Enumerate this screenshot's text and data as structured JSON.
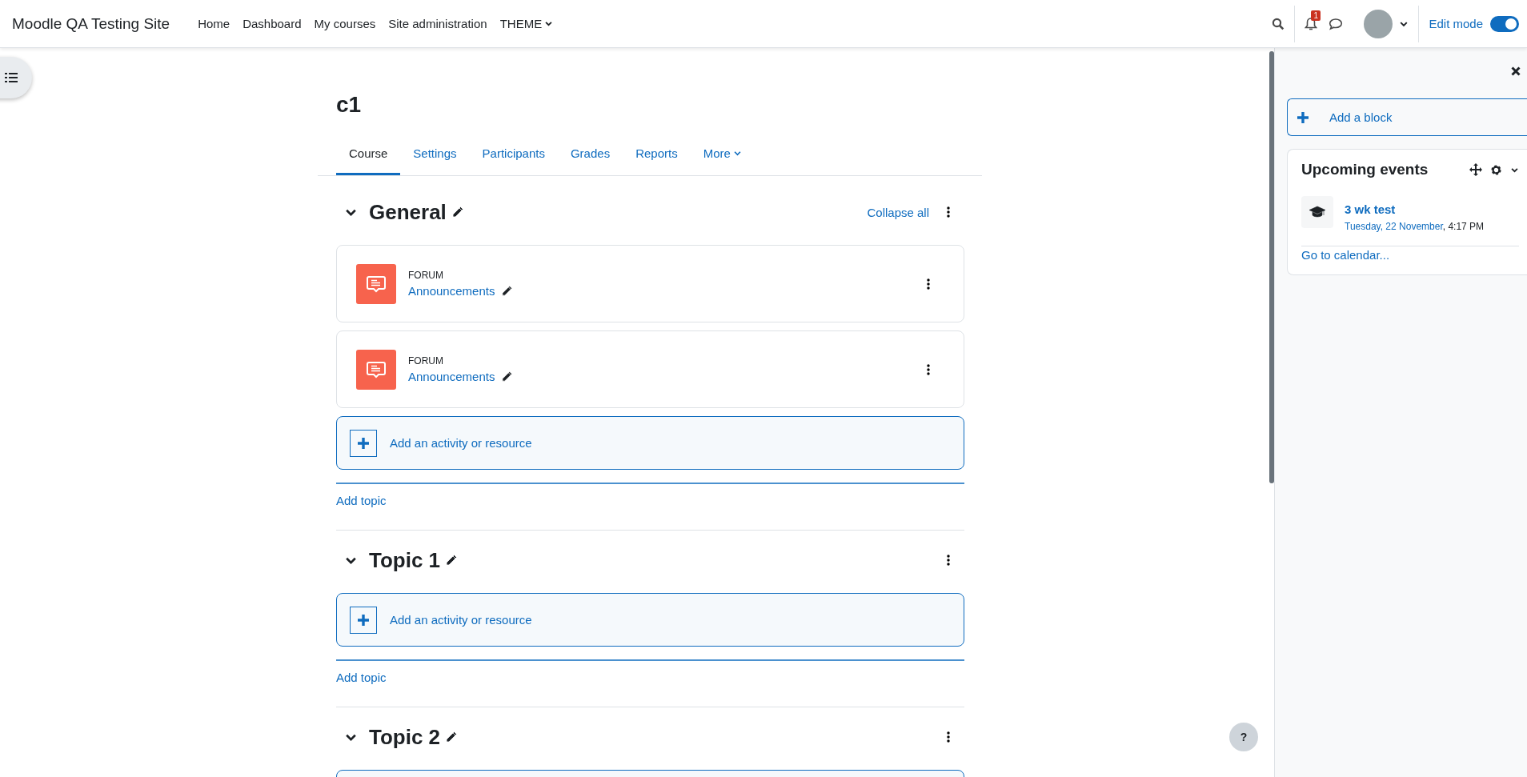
{
  "navbar": {
    "site_name": "Moodle QA Testing Site",
    "menu": [
      {
        "label": "Home",
        "dropdown": false
      },
      {
        "label": "Dashboard",
        "dropdown": false
      },
      {
        "label": "My courses",
        "dropdown": false
      },
      {
        "label": "Site administration",
        "dropdown": false
      },
      {
        "label": "THEME",
        "dropdown": true
      }
    ],
    "notification_count": "1",
    "edit_mode": {
      "label": "Edit mode",
      "on": true
    }
  },
  "course": {
    "title": "c1",
    "tabs": [
      {
        "label": "Course",
        "selected": true,
        "dropdown": false
      },
      {
        "label": "Settings",
        "selected": false,
        "dropdown": false
      },
      {
        "label": "Participants",
        "selected": false,
        "dropdown": false
      },
      {
        "label": "Grades",
        "selected": false,
        "dropdown": false
      },
      {
        "label": "Reports",
        "selected": false,
        "dropdown": false
      },
      {
        "label": "More",
        "selected": false,
        "dropdown": true
      }
    ]
  },
  "sections": [
    {
      "title": "General",
      "collapse_all": "Collapse all",
      "activities": [
        {
          "type": "FORUM",
          "name": "Announcements"
        },
        {
          "type": "FORUM",
          "name": "Announcements"
        }
      ],
      "add_activity": "Add an activity or resource",
      "add_topic": "Add topic"
    },
    {
      "title": "Topic 1",
      "add_activity": "Add an activity or resource",
      "add_topic": "Add topic"
    },
    {
      "title": "Topic 2"
    }
  ],
  "drawer": {
    "add_block": "Add a block",
    "block": {
      "title": "Upcoming events",
      "events": [
        {
          "name": "3 wk test",
          "date": "Tuesday, 22 November",
          "time": ", 4:17 PM"
        }
      ],
      "footer_link": "Go to calendar..."
    }
  },
  "help_button": "?"
}
